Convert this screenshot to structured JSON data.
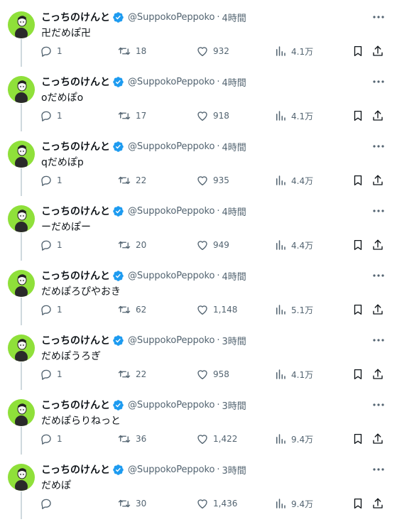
{
  "timeline": {
    "tweets": [
      {
        "name": "こっちのけんと",
        "handle": "@SuppokoPeppoko",
        "sep": "·",
        "time": "4時間",
        "text": "卍だめぽ卍",
        "replies": "1",
        "retweets": "18",
        "likes": "932",
        "views": "4.1万"
      },
      {
        "name": "こっちのけんと",
        "handle": "@SuppokoPeppoko",
        "sep": "·",
        "time": "4時間",
        "text": "oだめぽo",
        "replies": "1",
        "retweets": "17",
        "likes": "918",
        "views": "4.1万"
      },
      {
        "name": "こっちのけんと",
        "handle": "@SuppokoPeppoko",
        "sep": "·",
        "time": "4時間",
        "text": "qだめぽp",
        "replies": "1",
        "retweets": "22",
        "likes": "935",
        "views": "4.4万"
      },
      {
        "name": "こっちのけんと",
        "handle": "@SuppokoPeppoko",
        "sep": "·",
        "time": "4時間",
        "text": "ーだめぽー",
        "replies": "1",
        "retweets": "20",
        "likes": "949",
        "views": "4.4万"
      },
      {
        "name": "こっちのけんと",
        "handle": "@SuppokoPeppoko",
        "sep": "·",
        "time": "4時間",
        "text": "だめぽろぴやおき",
        "replies": "1",
        "retweets": "62",
        "likes": "1,148",
        "views": "5.1万"
      },
      {
        "name": "こっちのけんと",
        "handle": "@SuppokoPeppoko",
        "sep": "·",
        "time": "3時間",
        "text": "だめぽうろぎ",
        "replies": "1",
        "retweets": "22",
        "likes": "958",
        "views": "4.1万"
      },
      {
        "name": "こっちのけんと",
        "handle": "@SuppokoPeppoko",
        "sep": "·",
        "time": "3時間",
        "text": "だめぽらりねっと",
        "replies": "1",
        "retweets": "36",
        "likes": "1,422",
        "views": "9.4万"
      },
      {
        "name": "こっちのけんと",
        "handle": "@SuppokoPeppoko",
        "sep": "·",
        "time": "3時間",
        "text": "だめぽ",
        "replies": "",
        "retweets": "30",
        "likes": "1,436",
        "views": "9.4万"
      }
    ]
  },
  "icons": {
    "verified": "verified-badge-icon",
    "more": "more-dots-icon",
    "reply": "reply-icon",
    "retweet": "retweet-icon",
    "like": "heart-icon",
    "views": "views-chart-icon",
    "bookmark": "bookmark-icon",
    "share": "share-icon"
  },
  "colors": {
    "verified_blue": "#1d9bf0",
    "avatar_green": "#8fe03a",
    "text_primary": "#0f1419",
    "text_secondary": "#536471",
    "thread_line": "#cfd9de"
  }
}
